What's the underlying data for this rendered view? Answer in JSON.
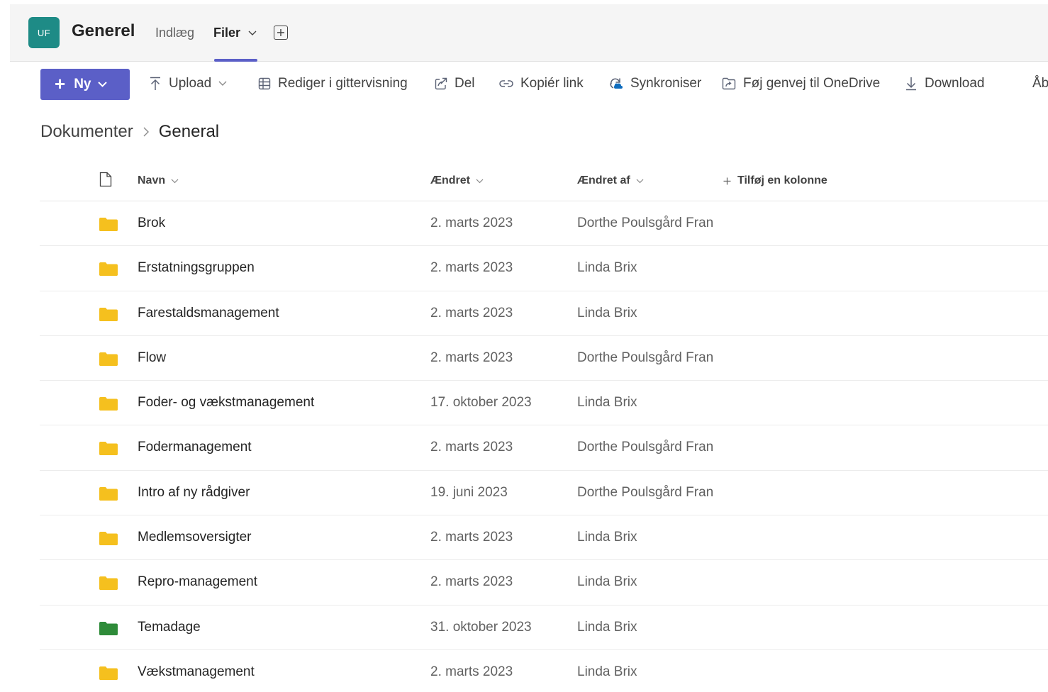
{
  "header": {
    "team_initials": "UF",
    "channel_title": "Generel",
    "tabs": [
      {
        "label": "Indlæg"
      },
      {
        "label": "Filer"
      }
    ]
  },
  "toolbar": {
    "new_label": "Ny",
    "upload_label": "Upload",
    "grid_edit_label": "Rediger i gittervisning",
    "share_label": "Del",
    "copy_link_label": "Kopiér link",
    "sync_label": "Synkroniser",
    "shortcut_label": "Føj genvej til OneDrive",
    "download_label": "Download",
    "open_label_truncated": "Åb"
  },
  "breadcrumb": {
    "root": "Dokumenter",
    "current": "General"
  },
  "columns": {
    "name": "Navn",
    "modified": "Ændret",
    "modified_by": "Ændret af",
    "add_column": "Tilføj en kolonne"
  },
  "rows": [
    {
      "name": "Brok",
      "modified": "2. marts 2023",
      "modified_by": "Dorthe Poulsgård Fran",
      "folder_color": "#f5c01f"
    },
    {
      "name": "Erstatningsgruppen",
      "modified": "2. marts 2023",
      "modified_by": "Linda Brix",
      "folder_color": "#f5c01f"
    },
    {
      "name": "Farestaldsmanagement",
      "modified": "2. marts 2023",
      "modified_by": "Linda Brix",
      "folder_color": "#f5c01f"
    },
    {
      "name": "Flow",
      "modified": "2. marts 2023",
      "modified_by": "Dorthe Poulsgård Fran",
      "folder_color": "#f5c01f"
    },
    {
      "name": "Foder- og vækstmanagement",
      "modified": "17. oktober 2023",
      "modified_by": "Linda Brix",
      "folder_color": "#f5c01f"
    },
    {
      "name": "Fodermanagement",
      "modified": "2. marts 2023",
      "modified_by": "Dorthe Poulsgård Fran",
      "folder_color": "#f5c01f"
    },
    {
      "name": "Intro af ny rådgiver",
      "modified": "19. juni 2023",
      "modified_by": "Dorthe Poulsgård Fran",
      "folder_color": "#f5c01f"
    },
    {
      "name": "Medlemsoversigter",
      "modified": "2. marts 2023",
      "modified_by": "Linda Brix",
      "folder_color": "#f5c01f"
    },
    {
      "name": "Repro-management",
      "modified": "2. marts 2023",
      "modified_by": "Linda Brix",
      "folder_color": "#f5c01f"
    },
    {
      "name": "Temadage",
      "modified": "31. oktober 2023",
      "modified_by": "Linda Brix",
      "folder_color": "#2e8b3a"
    },
    {
      "name": "Vækstmanagement",
      "modified": "2. marts 2023",
      "modified_by": "Linda Brix",
      "folder_color": "#f5c01f"
    }
  ],
  "colors": {
    "accent": "#5b5fc7",
    "team_avatar": "#1e8b86"
  }
}
